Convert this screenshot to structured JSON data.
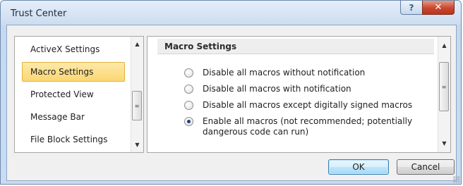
{
  "window": {
    "title": "Trust Center",
    "help_glyph": "?",
    "close_glyph": "✕"
  },
  "nav": {
    "items": [
      {
        "label": "ActiveX Settings",
        "selected": false
      },
      {
        "label": "Macro Settings",
        "selected": true
      },
      {
        "label": "Protected View",
        "selected": false
      },
      {
        "label": "Message Bar",
        "selected": false
      },
      {
        "label": "File Block Settings",
        "selected": false
      }
    ],
    "scroll_up": "▲",
    "scroll_down": "▼",
    "thumb_grip": "≡"
  },
  "content": {
    "section_title": "Macro Settings",
    "options": [
      {
        "label": "Disable all macros without notification",
        "checked": false
      },
      {
        "label": "Disable all macros with notification",
        "checked": false
      },
      {
        "label": "Disable all macros except digitally signed macros",
        "checked": false
      },
      {
        "label": "Enable all macros (not recommended; potentially dangerous code can run)",
        "checked": true
      }
    ],
    "scroll_up": "▲",
    "scroll_down": "▼",
    "thumb_grip": "≡"
  },
  "buttons": {
    "ok": "OK",
    "cancel": "Cancel"
  },
  "colors": {
    "selected_nav_bg": "#fbd773",
    "close_button": "#c9472e",
    "ok_border": "#3c7fb1"
  }
}
